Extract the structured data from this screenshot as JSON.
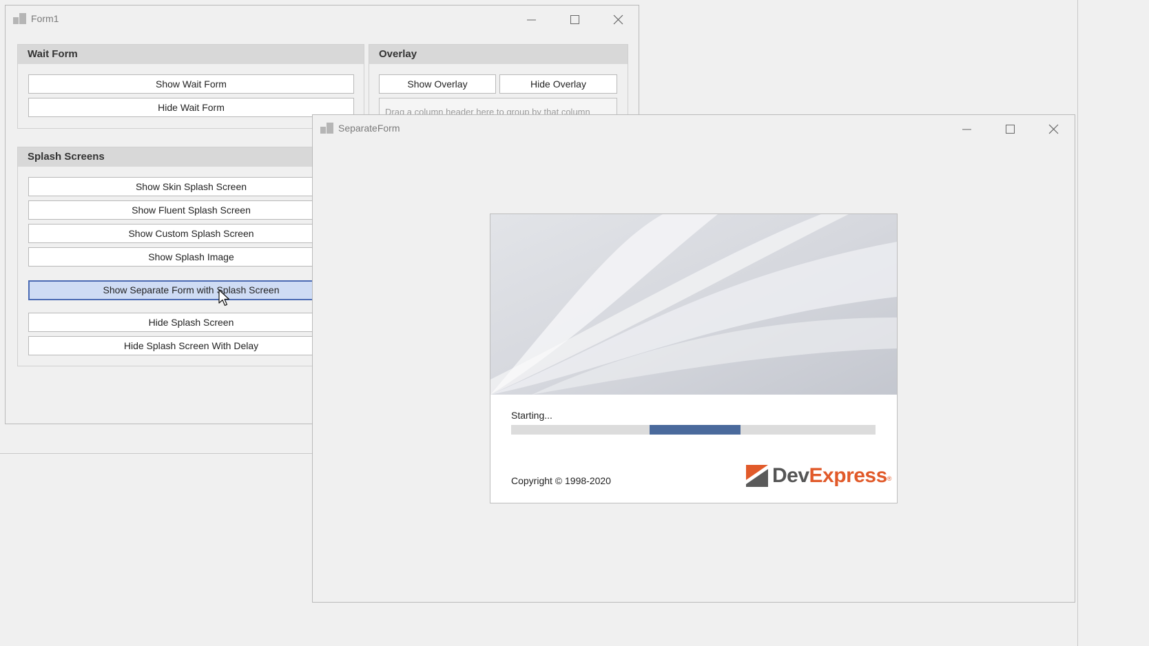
{
  "form1": {
    "title": "Form1",
    "wait_form": {
      "header": "Wait Form",
      "buttons": [
        "Show Wait Form",
        "Hide Wait Form"
      ]
    },
    "overlay": {
      "header": "Overlay",
      "buttons": [
        "Show Overlay",
        "Hide Overlay"
      ],
      "grid_hint": "Drag a column header here to group by that column"
    },
    "splash_screens": {
      "header": "Splash Screens",
      "buttons": [
        "Show Skin Splash Screen",
        "Show Fluent Splash Screen",
        "Show Custom Splash Screen",
        "Show Splash Image",
        "Show Separate Form with Splash Screen",
        "Hide Splash Screen",
        "Hide Splash Screen With Delay"
      ],
      "active_button_index": 4
    }
  },
  "separate_form": {
    "title": "SeparateForm",
    "splash": {
      "status": "Starting...",
      "progress": {
        "start_fraction": 0.38,
        "end_fraction": 0.63
      },
      "copyright": "Copyright © 1998-2020",
      "logo": {
        "part1": "Dev",
        "part2": "Express",
        "mark": "®"
      }
    }
  },
  "colors": {
    "accent_blue": "#4a6ab3",
    "progress_fill": "#4a6a9c",
    "logo_orange": "#e15a2a",
    "group_header": "#d8d8d8"
  },
  "icons": {
    "app": "app-icon",
    "minimize": "minimize-icon",
    "maximize": "maximize-icon",
    "close": "close-icon",
    "cursor": "mouse-pointer-icon"
  }
}
